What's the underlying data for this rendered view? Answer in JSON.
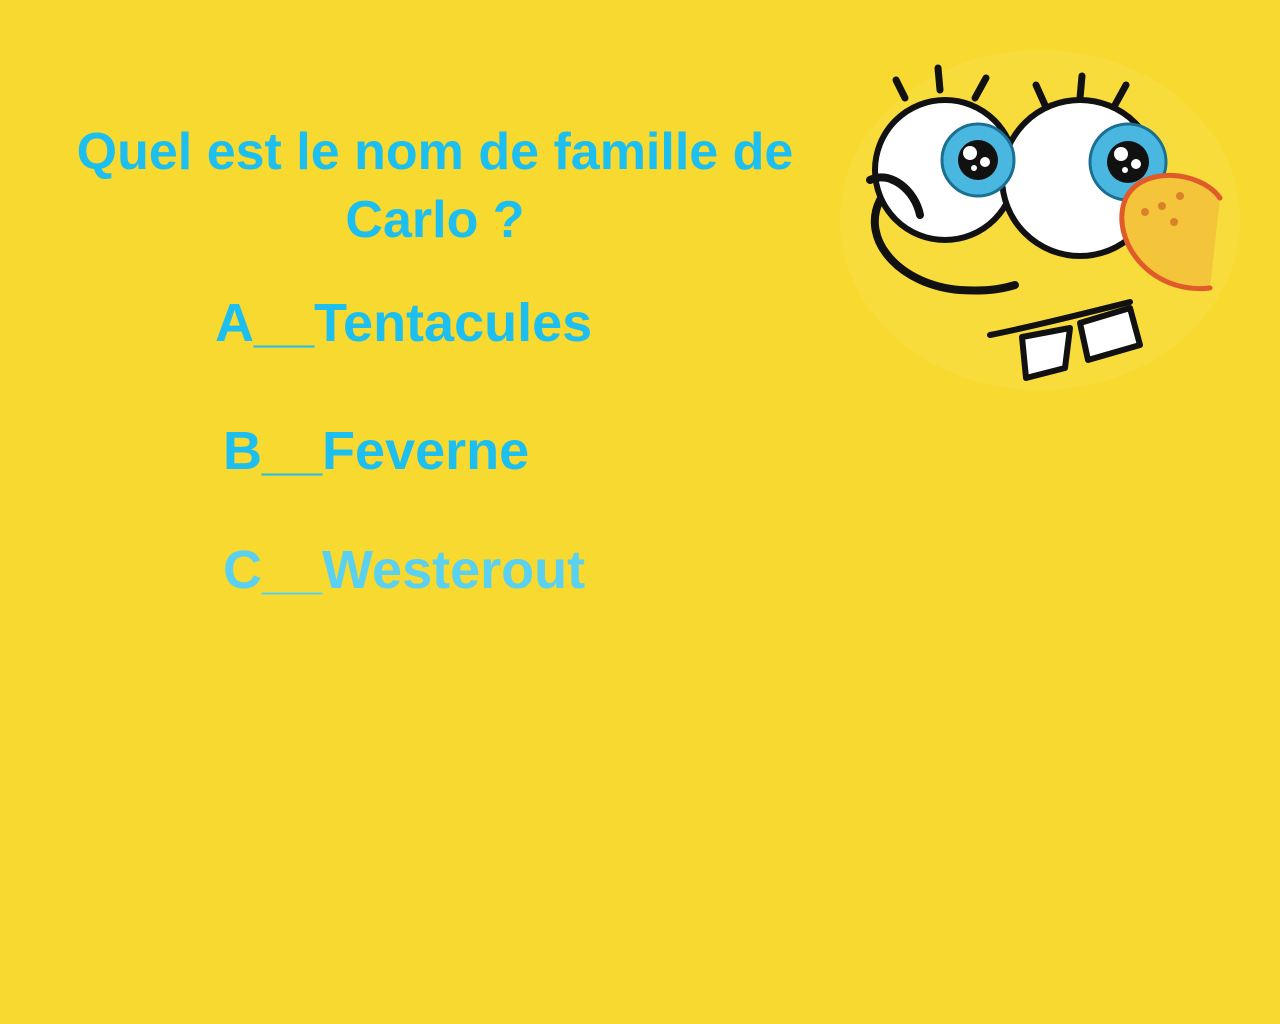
{
  "quiz": {
    "question": "Quel est le nom de famille de Carlo ?",
    "answers": [
      {
        "letter": "A",
        "text": "A__Tentacules"
      },
      {
        "letter": "B",
        "text": "B__Feverne"
      },
      {
        "letter": "C",
        "text": "C__Westerout"
      }
    ]
  },
  "illustration": {
    "icon": "cartoon-sponge-face-icon"
  },
  "colors": {
    "background": "#f7d92f",
    "text": "#1cbfef",
    "text_faded": "#5ad1f0",
    "eye_iris": "#4ab7e0",
    "nose": "#f1b73a",
    "nose_outline": "#e05a2a"
  }
}
